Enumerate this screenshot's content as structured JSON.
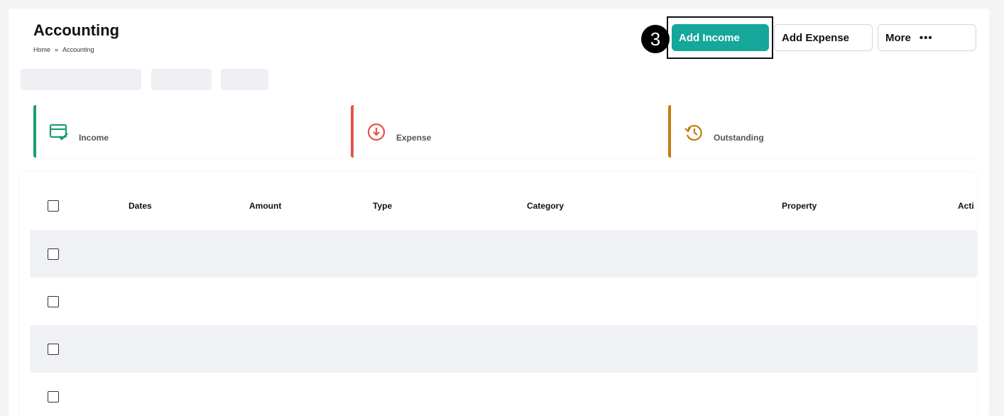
{
  "header": {
    "title": "Accounting",
    "breadcrumb": {
      "home": "Home",
      "separator": "»",
      "current": "Accounting"
    }
  },
  "actions": {
    "add_income": "Add Income",
    "add_expense": "Add Expense",
    "more": "More",
    "more_icon": "•••"
  },
  "step_marker": {
    "number": "3"
  },
  "summary_cards": [
    {
      "label": "Income",
      "icon": "card-check-icon",
      "color": "#1a9e6e"
    },
    {
      "label": "Expense",
      "icon": "arrow-down-circle-icon",
      "color": "#e5534b"
    },
    {
      "label": "Outstanding",
      "icon": "history-clock-icon",
      "color": "#c47d0e"
    }
  ],
  "table": {
    "columns": [
      "Dates",
      "Amount",
      "Type",
      "Category",
      "Property",
      "Acti"
    ],
    "rows": 4
  },
  "colors": {
    "accent": "#14a79a"
  }
}
